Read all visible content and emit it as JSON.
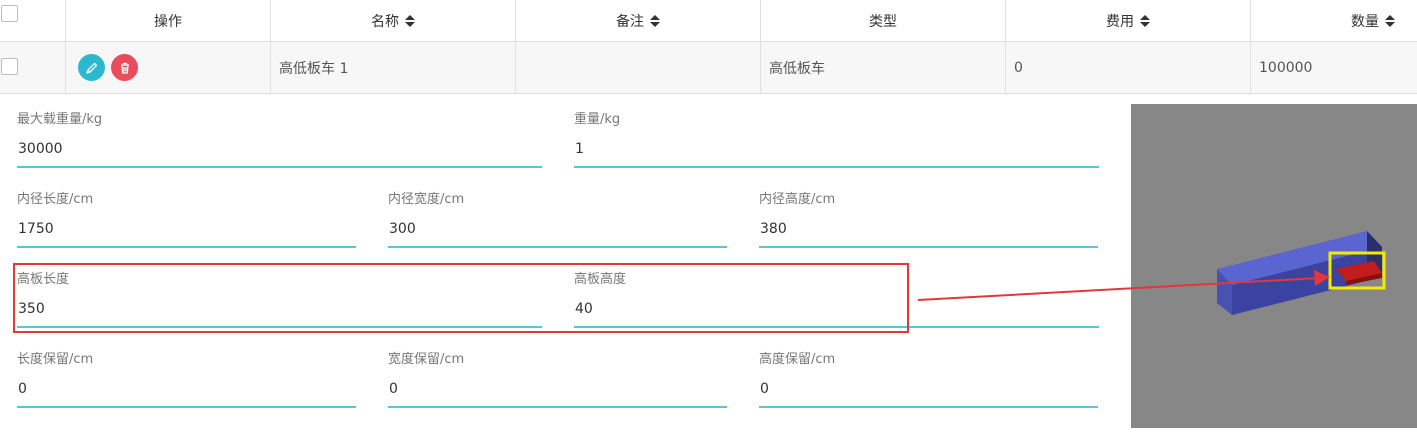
{
  "table": {
    "headers": [
      {
        "label": "",
        "sortable": false
      },
      {
        "label": "操作",
        "sortable": false
      },
      {
        "label": "名称",
        "sortable": true
      },
      {
        "label": "备注",
        "sortable": true
      },
      {
        "label": "类型",
        "sortable": false
      },
      {
        "label": "费用",
        "sortable": true
      },
      {
        "label": "数量",
        "sortable": true
      }
    ],
    "row": {
      "name": "高低板车 1",
      "remark": "",
      "type": "高低板车",
      "cost": "0",
      "quantity": "100000",
      "actions": {
        "edit_icon": "pencil-icon",
        "delete_icon": "trash-icon"
      }
    }
  },
  "form": {
    "max_load": {
      "label": "最大载重量/kg",
      "value": "30000"
    },
    "weight": {
      "label": "重量/kg",
      "value": "1"
    },
    "inner_length": {
      "label": "内径长度/cm",
      "value": "1750"
    },
    "inner_width": {
      "label": "内径宽度/cm",
      "value": "300"
    },
    "inner_height": {
      "label": "内径高度/cm",
      "value": "380"
    },
    "high_board_length": {
      "label": "高板长度",
      "value": "350"
    },
    "high_board_height": {
      "label": "高板高度",
      "value": "40"
    },
    "length_reserve": {
      "label": "长度保留/cm",
      "value": "0"
    },
    "width_reserve": {
      "label": "宽度保留/cm",
      "value": "0"
    },
    "height_reserve": {
      "label": "高度保留/cm",
      "value": "0"
    }
  },
  "colors": {
    "accent": "#5cc4d9",
    "edit_button": "#2bb9d2",
    "delete_button": "#ea4c5b",
    "annotation_red": "#e2373b",
    "annotation_yellow": "#f2ea00",
    "preview_bg": "#878787",
    "truck_body": "#5a63c8",
    "high_board": "#c21d1d"
  }
}
